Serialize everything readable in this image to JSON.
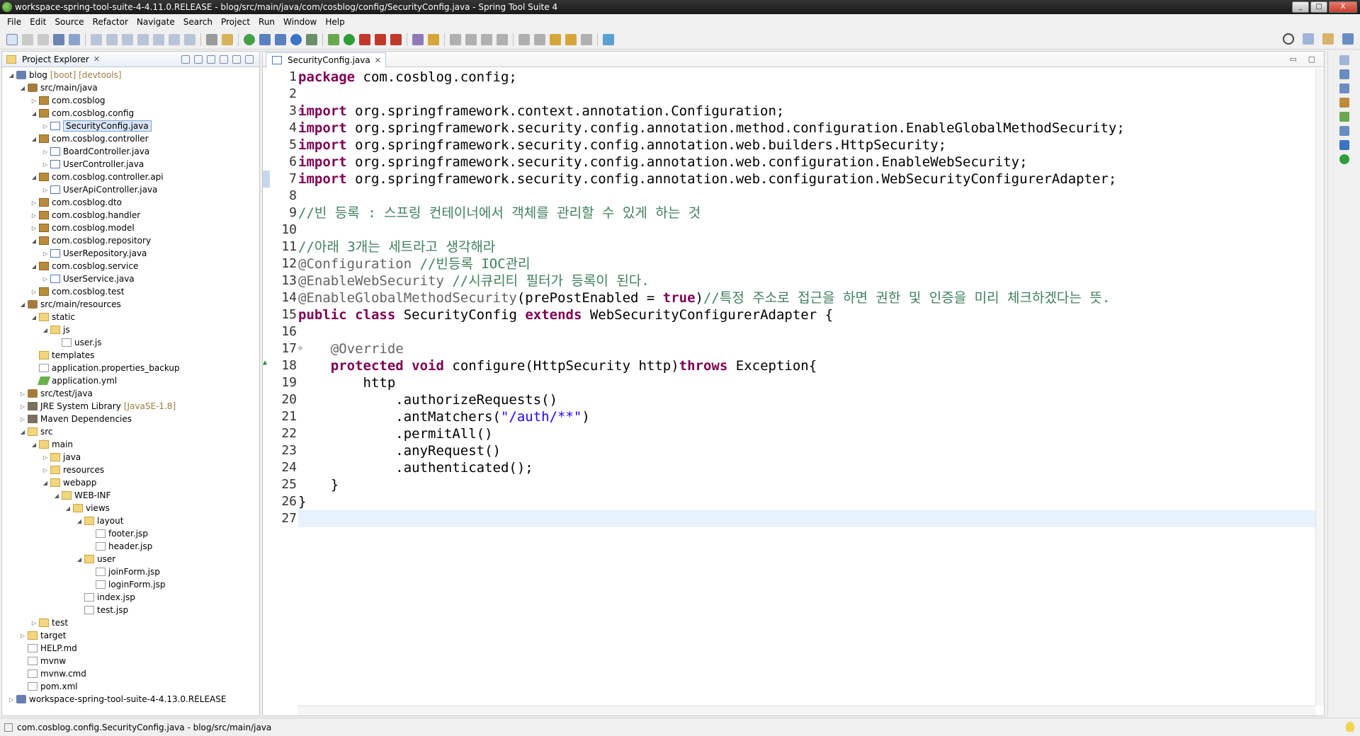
{
  "window": {
    "title": "workspace-spring-tool-suite-4-4.11.0.RELEASE - blog/src/main/java/com/cosblog/config/SecurityConfig.java - Spring Tool Suite 4",
    "minimize": "_",
    "maximize": "□",
    "close": "X"
  },
  "menu": [
    "File",
    "Edit",
    "Source",
    "Refactor",
    "Navigate",
    "Search",
    "Project",
    "Run",
    "Window",
    "Help"
  ],
  "explorer": {
    "tab_label": "Project Explorer",
    "close": "✕",
    "items": [
      {
        "label": "blog",
        "deco": "[boot] [devtools]"
      },
      {
        "label": "src/main/java"
      },
      {
        "label": "com.cosblog"
      },
      {
        "label": "com.cosblog.config"
      },
      {
        "label": "SecurityConfig.java"
      },
      {
        "label": "com.cosblog.controller"
      },
      {
        "label": "BoardController.java"
      },
      {
        "label": "UserController.java"
      },
      {
        "label": "com.cosblog.controller.api"
      },
      {
        "label": "UserApiController.java"
      },
      {
        "label": "com.cosblog.dto"
      },
      {
        "label": "com.cosblog.handler"
      },
      {
        "label": "com.cosblog.model"
      },
      {
        "label": "com.cosblog.repository"
      },
      {
        "label": "UserRepository.java"
      },
      {
        "label": "com.cosblog.service"
      },
      {
        "label": "UserService.java"
      },
      {
        "label": "com.cosblog.test"
      },
      {
        "label": "src/main/resources"
      },
      {
        "label": "static"
      },
      {
        "label": "js"
      },
      {
        "label": "user.js"
      },
      {
        "label": "templates"
      },
      {
        "label": "application.properties_backup"
      },
      {
        "label": "application.yml"
      },
      {
        "label": "src/test/java"
      },
      {
        "label": "JRE System Library",
        "deco": "[JavaSE-1.8]"
      },
      {
        "label": "Maven Dependencies"
      },
      {
        "label": "src"
      },
      {
        "label": "main"
      },
      {
        "label": "java"
      },
      {
        "label": "resources"
      },
      {
        "label": "webapp"
      },
      {
        "label": "WEB-INF"
      },
      {
        "label": "views"
      },
      {
        "label": "layout"
      },
      {
        "label": "footer.jsp"
      },
      {
        "label": "header.jsp"
      },
      {
        "label": "user"
      },
      {
        "label": "joinForm.jsp"
      },
      {
        "label": "loginForm.jsp"
      },
      {
        "label": "index.jsp"
      },
      {
        "label": "test.jsp"
      },
      {
        "label": "test"
      },
      {
        "label": "target"
      },
      {
        "label": "HELP.md"
      },
      {
        "label": "mvnw"
      },
      {
        "label": "mvnw.cmd"
      },
      {
        "label": "pom.xml"
      },
      {
        "label": "workspace-spring-tool-suite-4-4.13.0.RELEASE"
      }
    ]
  },
  "editor": {
    "tab_label": "SecurityConfig.java",
    "close": "✕",
    "line_numbers": [
      "1",
      "2",
      "3",
      "4",
      "5",
      "6",
      "7",
      "8",
      "9",
      "10",
      "11",
      "12",
      "13",
      "14",
      "15",
      "16",
      "17",
      "18",
      "19",
      "20",
      "21",
      "22",
      "23",
      "24",
      "25",
      "26",
      "27"
    ]
  },
  "status": {
    "text": "com.cosblog.config.SecurityConfig.java - blog/src/main/java"
  },
  "colors": {
    "keyword": "#7f0055",
    "comment": "#3f7f5f",
    "annotation": "#646464",
    "string": "#2a00ff",
    "current_line": "#e8f2fe"
  }
}
